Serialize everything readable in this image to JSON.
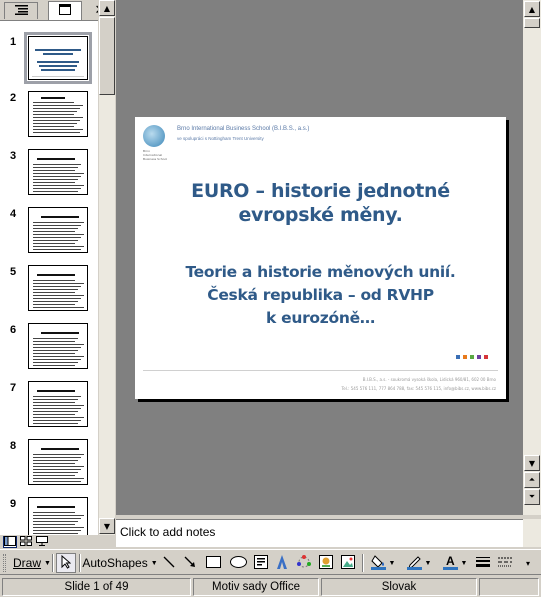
{
  "outline_tabs": {
    "outline_icon": "outline-list-icon",
    "slides_icon": "slides-tab-icon",
    "close_glyph": "✕"
  },
  "thumbnails": [
    {
      "number": "1"
    },
    {
      "number": "2"
    },
    {
      "number": "3"
    },
    {
      "number": "4"
    },
    {
      "number": "5"
    },
    {
      "number": "6"
    },
    {
      "number": "7"
    },
    {
      "number": "8"
    },
    {
      "number": "9"
    }
  ],
  "slide": {
    "school_name": "Brno International Business School (B.I.B.S., a.s.)",
    "school_sub": "ve spolupráci s Nottingham Trent University",
    "logo_line1": "Brno",
    "logo_line2": "International",
    "logo_line3": "Business School",
    "title": "EURO – historie jednotné evropské měny.",
    "subtitle_lines": [
      "Teorie a historie měnových unií.",
      "Česká republika – od RVHP",
      "k eurozóně…"
    ],
    "footer_line1": "B.I.B.S., a.s. - soukromá vysoká škola, Lidická 960/81, 602 00 Brno",
    "footer_line2": "Tel.: 545 576 111, 777 864 788, fax: 545 576 115, info@bibs.cz, www.bibs.cz",
    "accent_colors": [
      "#3a6fb5",
      "#e87a1c",
      "#5aa843",
      "#6d3ea0",
      "#d6353a"
    ]
  },
  "notes": {
    "placeholder": "Click to add notes"
  },
  "toolbar": {
    "draw_label": "Draw",
    "autoshapes_label": "AutoShapes"
  },
  "status": {
    "slide_info": "Slide 1 of 49",
    "design": "Motiv sady Office",
    "language": "Slovak"
  }
}
